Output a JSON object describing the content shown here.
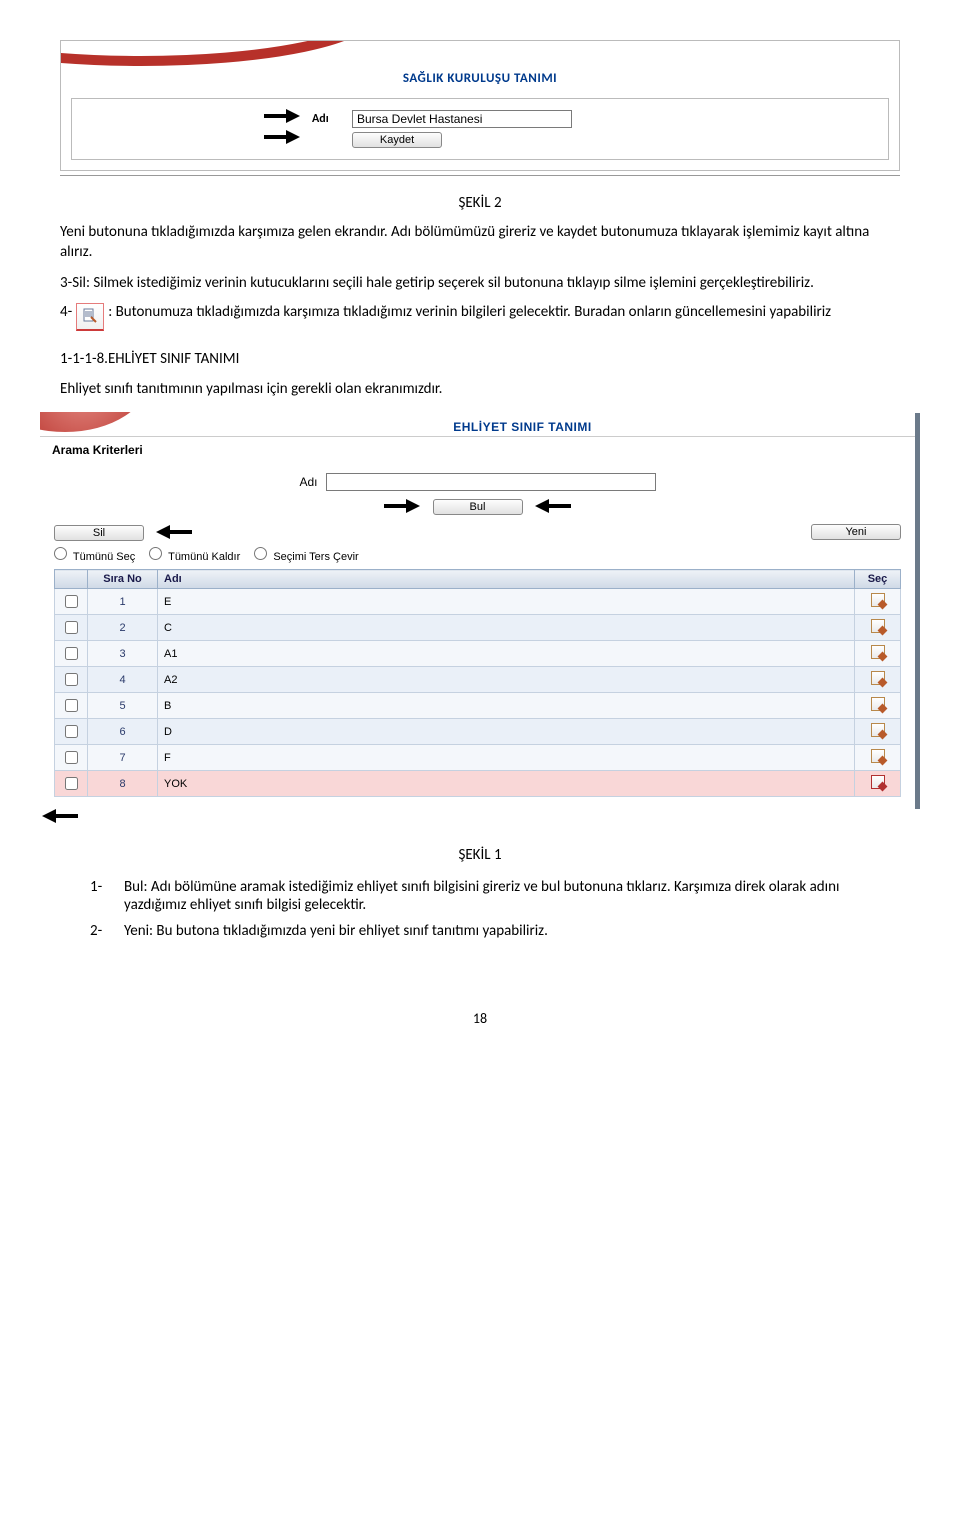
{
  "ss1": {
    "title": "SAĞLIK KURULUŞU TANIMI",
    "label_adi": "Adı",
    "input_value": "Bursa Devlet Hastanesi",
    "btn_kaydet": "Kaydet"
  },
  "fig2_label": "ŞEKİL 2",
  "para_yeni": "Yeni butonuna tıkladığımızda karşımıza gelen ekrandır. Adı bölümümüzü gireriz ve kaydet butonumuza tıklayarak işlemimiz kayıt altına alırız.",
  "para_sil": "3-Sil: Silmek istediğimiz verinin kutucuklarını seçili hale getirip seçerek sil butonuna tıklayıp silme işlemini gerçekleştirebiliriz.",
  "para4_prefix": "4-",
  "para4_rest": ": Butonumuza tıkladığımızda karşımıza tıkladığımız verinin bilgileri gelecektir. Buradan onların güncellemesini yapabiliriz",
  "section_head": "1-1-1-8.EHLİYET SINIF TANIMI",
  "section_intro": "Ehliyet sınıfı tanıtımının yapılması için gerekli olan ekranımızdır.",
  "ss2": {
    "title": "EHLİYET SINIF TANIMI",
    "arama": "Arama Kriterleri",
    "label_adi": "Adı",
    "btn_bul": "Bul",
    "btn_sil": "Sil",
    "btn_yeni": "Yeni",
    "radios": [
      "Tümünü Seç",
      "Tümünü Kaldır",
      "Seçimi Ters Çevir"
    ],
    "headers": {
      "sira": "Sıra No",
      "adi": "Adı",
      "sec": "Seç"
    },
    "rows": [
      {
        "no": "1",
        "adi": "E"
      },
      {
        "no": "2",
        "adi": "C"
      },
      {
        "no": "3",
        "adi": "A1"
      },
      {
        "no": "4",
        "adi": "A2"
      },
      {
        "no": "5",
        "adi": "B"
      },
      {
        "no": "6",
        "adi": "D"
      },
      {
        "no": "7",
        "adi": "F"
      },
      {
        "no": "8",
        "adi": "YOK"
      }
    ]
  },
  "fig1_label": "ŞEKİL 1",
  "list": [
    {
      "num": "1-",
      "text": "Bul: Adı bölümüne aramak istediğimiz ehliyet sınıfı bilgisini gireriz ve bul butonuna tıklarız. Karşımıza direk olarak adını yazdığımız ehliyet sınıfı bilgisi gelecektir."
    },
    {
      "num": "2-",
      "text": "Yeni:  Bu butona tıkladığımızda yeni bir ehliyet sınıf tanıtımı yapabiliriz."
    }
  ],
  "page_number": "18"
}
